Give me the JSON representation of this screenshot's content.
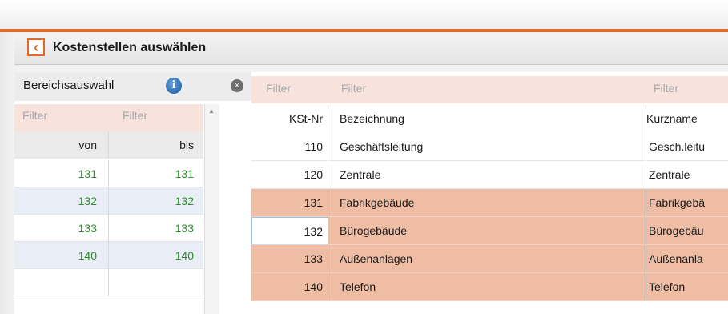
{
  "window": {
    "title": "Kostenstellen auswählen",
    "accent_color": "#e06a2a",
    "back_icon": "chevron-left-icon"
  },
  "left_panel": {
    "header": "Bereichsauswahl",
    "info_icon": "i",
    "close_icon": "×",
    "filters": [
      "Filter",
      "Filter"
    ],
    "columns": [
      "von",
      "bis"
    ],
    "rows": [
      {
        "von": "131",
        "bis": "131"
      },
      {
        "von": "132",
        "bis": "132"
      },
      {
        "von": "133",
        "bis": "133"
      },
      {
        "von": "140",
        "bis": "140"
      }
    ],
    "scroll_up_icon": "▲"
  },
  "right_panel": {
    "filters": [
      "Filter",
      "Filter",
      "Filter"
    ],
    "columns": [
      "KSt-Nr",
      "Bezeichnung",
      "Kurzname"
    ],
    "rows": [
      {
        "nr": "110",
        "bezeichnung": "Geschäftsleitung",
        "kurzname": "Gesch.leitu",
        "selected": false
      },
      {
        "nr": "120",
        "bezeichnung": "Zentrale",
        "kurzname": "Zentrale",
        "selected": false
      },
      {
        "nr": "131",
        "bezeichnung": "Fabrikgebäude",
        "kurzname": "Fabrikgebä",
        "selected": true
      },
      {
        "nr": "132",
        "bezeichnung": "Bürogebäude",
        "kurzname": "Bürogebäu",
        "selected": true
      },
      {
        "nr": "133",
        "bezeichnung": "Außenanlagen",
        "kurzname": "Außenanla",
        "selected": true
      },
      {
        "nr": "140",
        "bezeichnung": "Telefon",
        "kurzname": "Telefon",
        "selected": true
      }
    ]
  }
}
